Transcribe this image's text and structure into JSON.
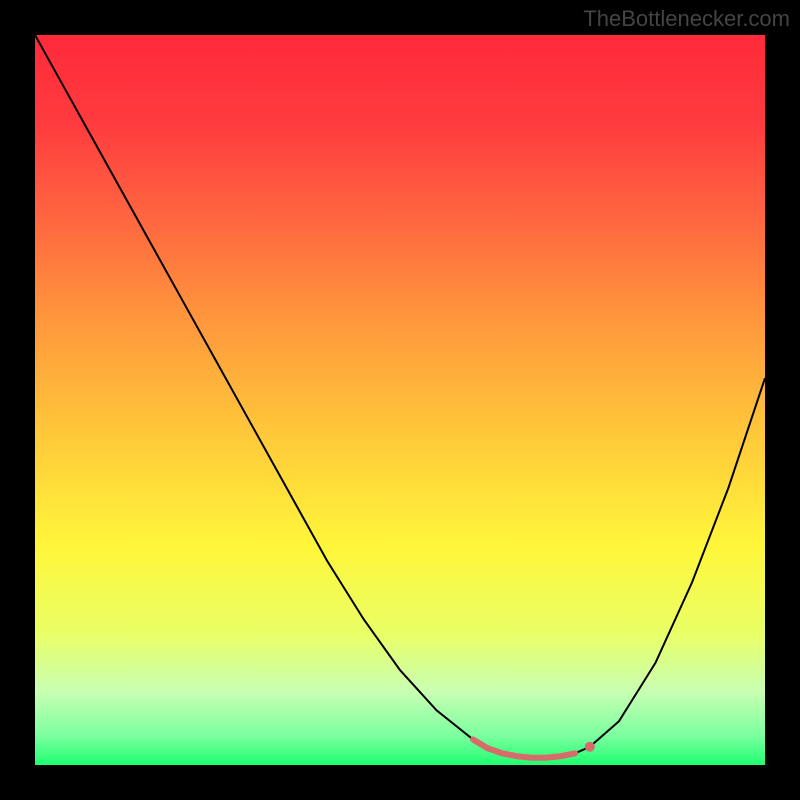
{
  "watermark": "TheBottlenecker.com",
  "chart_data": {
    "type": "line",
    "title": "",
    "xlabel": "",
    "ylabel": "",
    "xlim": [
      0,
      100
    ],
    "ylim": [
      0,
      100
    ],
    "grid": false,
    "background_gradient": {
      "stops": [
        {
          "offset": 0,
          "color": "#ff2a3a"
        },
        {
          "offset": 12,
          "color": "#ff3b3f"
        },
        {
          "offset": 25,
          "color": "#ff6640"
        },
        {
          "offset": 40,
          "color": "#ff9a3c"
        },
        {
          "offset": 55,
          "color": "#ffc93a"
        },
        {
          "offset": 70,
          "color": "#fff63a"
        },
        {
          "offset": 82,
          "color": "#e9ff66"
        },
        {
          "offset": 90,
          "color": "#c8ffb3"
        },
        {
          "offset": 96,
          "color": "#7bff9f"
        },
        {
          "offset": 100,
          "color": "#1eff70"
        }
      ]
    },
    "series": [
      {
        "name": "bottleneck-curve",
        "color": "#000000",
        "stroke_width": 2,
        "x": [
          0,
          5,
          10,
          15,
          20,
          25,
          30,
          35,
          40,
          45,
          50,
          55,
          60,
          62,
          64,
          66,
          68,
          70,
          72,
          74,
          76,
          80,
          85,
          90,
          95,
          100
        ],
        "y": [
          100,
          91,
          82,
          73,
          64,
          55,
          46,
          37,
          28,
          20,
          13,
          7.5,
          3.5,
          2.3,
          1.6,
          1.2,
          1.0,
          1.0,
          1.2,
          1.6,
          2.5,
          6,
          14,
          25,
          38,
          53
        ]
      }
    ],
    "highlight_segment": {
      "color": "#d86a6a",
      "stroke_width": 6,
      "x": [
        60,
        62,
        64,
        66,
        68,
        70,
        72,
        74
      ],
      "y": [
        3.5,
        2.3,
        1.6,
        1.2,
        1.0,
        1.0,
        1.2,
        1.6
      ]
    },
    "highlight_dot": {
      "color": "#d86a6a",
      "radius": 5,
      "x": 76,
      "y": 2.5
    }
  }
}
